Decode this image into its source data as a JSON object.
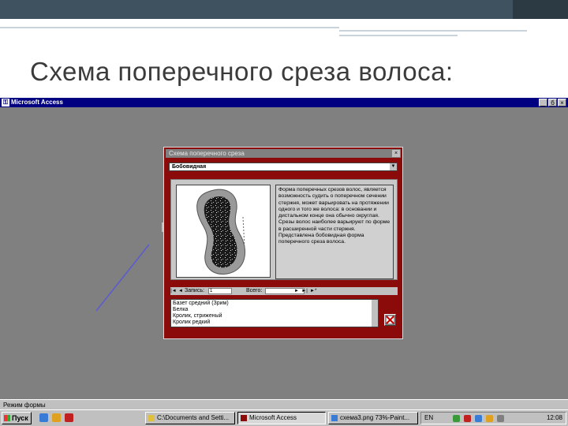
{
  "slide": {
    "title": "Схема поперечного среза волоса:"
  },
  "access_window": {
    "title": "Microsoft Access",
    "controls": {
      "minimize": "_",
      "maximize": "б",
      "close": "×"
    },
    "status_text": "Режим формы"
  },
  "form": {
    "title": "Схема поперечного среза",
    "close": "×",
    "combo_value": "Бобовидная",
    "description": "Форма поперечных срезов волос, является возможность судить о поперечном сечении стержня, может варьировать на протяжении одного и того же волоса: в основании и дистальном конце она обычно округлая. Срезы волос наиболее варьируют по форме в расширенной части стержня. Представлена бобовидная форма поперечного среза волоса.",
    "navigation": {
      "record_label": "Запись:",
      "record_value": "1",
      "total_label": "Всего:",
      "buttons": [
        "|◄",
        "◄",
        "►",
        "►|",
        "►*"
      ]
    },
    "list_items": [
      "Базет средний (Зрим)",
      "Белка",
      "Кролик, стриженый",
      "Кролик редкий"
    ]
  },
  "taskbar": {
    "start_label": "Пуск",
    "tasks": [
      {
        "label": "C:\\Documents and Setti...",
        "active": false
      },
      {
        "label": "Microsoft Access",
        "active": true
      },
      {
        "label": "схема3.png 73%-Paint...",
        "active": false
      }
    ],
    "lang": "EN",
    "clock": "12:08"
  },
  "colors": {
    "top_band": "#3f5260",
    "access_title": "#000080",
    "workspace": "#808080",
    "form_frame": "#8b0a0a",
    "arrow": "#5a5ad0"
  }
}
